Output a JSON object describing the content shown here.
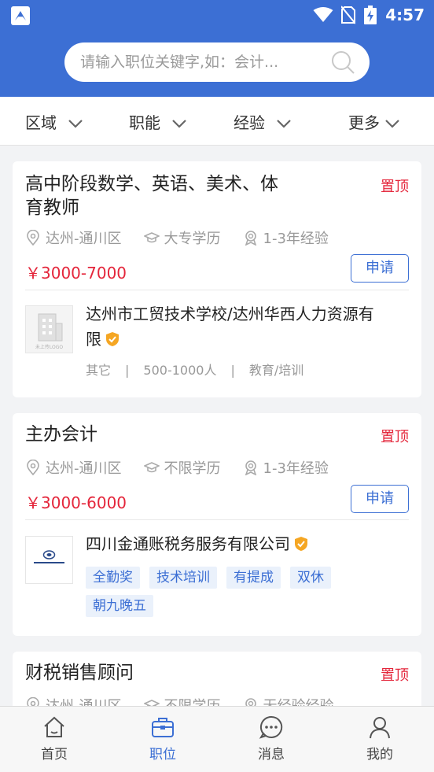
{
  "status_bar": {
    "time": "4:57"
  },
  "search": {
    "placeholder": "请输入职位关键字,如：会计..."
  },
  "filters": [
    {
      "label": "区域"
    },
    {
      "label": "职能"
    },
    {
      "label": "经验"
    },
    {
      "label": "更多"
    }
  ],
  "jobs": [
    {
      "title_line1": "高中阶段数学、英语、美术、体",
      "title_line2": "育教师",
      "top_tag": "置顶",
      "location": "达州-通川区",
      "education": "大专学历",
      "experience": "1-3年经验",
      "salary": "￥3000-7000",
      "apply_label": "申请",
      "company_line1": "达州市工贸技术学校/达州华西人力资源有",
      "company_line2": "限",
      "industry": "其它",
      "size": "500-1000人",
      "category": "教育/培训",
      "logo_text": "未上传LOGO"
    },
    {
      "title": "主办会计",
      "top_tag": "置顶",
      "location": "达州-通川区",
      "education": "不限学历",
      "experience": "1-3年经验",
      "salary": "￥3000-6000",
      "apply_label": "申请",
      "company": "四川金通账税务服务有限公司",
      "benefits": [
        "全勤奖",
        "技术培训",
        "有提成",
        "双休",
        "朝九晚五"
      ]
    },
    {
      "title": "财税销售顾问",
      "top_tag": "置顶",
      "location": "达州-通川区",
      "education": "不限学历",
      "experience": "无经验经验"
    }
  ],
  "bottom_nav": [
    {
      "label": "首页",
      "icon": "home-icon"
    },
    {
      "label": "职位",
      "icon": "briefcase-icon",
      "active": true
    },
    {
      "label": "消息",
      "icon": "message-icon"
    },
    {
      "label": "我的",
      "icon": "user-icon"
    }
  ],
  "colors": {
    "primary": "#3c6fd4",
    "accent_red": "#e4253a",
    "verified_orange": "#f5a623",
    "background": "#f2f3f5"
  }
}
